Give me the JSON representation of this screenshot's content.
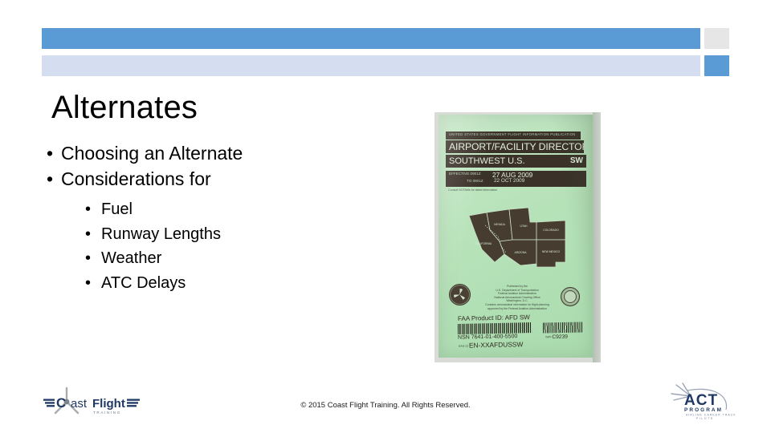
{
  "slide": {
    "title": "Alternates",
    "bullets": [
      {
        "text": "Choosing an Alternate",
        "marker": "•"
      },
      {
        "text": "Considerations for",
        "marker": "•"
      }
    ],
    "sub_bullets": [
      {
        "text": "Fuel",
        "marker": "•"
      },
      {
        "text": "Runway Lengths",
        "marker": "•"
      },
      {
        "text": "Weather",
        "marker": "•"
      },
      {
        "text": "ATC Delays",
        "marker": "•"
      }
    ]
  },
  "header": {
    "bar_top_color": "#5B9BD5",
    "block_top_right_color": "#E6E6E6",
    "bar_bottom_color": "#D4DEF0",
    "block_bottom_right_color": "#5B9BD5"
  },
  "photo": {
    "caption_alt": "Airport/Facility Directory Southwest U.S. booklet cover",
    "agency_line": "UNITED STATES GOVERNMENT FLIGHT INFORMATION PUBLICATION",
    "title": "AIRPORT/FACILITY DIRECTORY",
    "region": "SOUTHWEST U.S.",
    "region_code": "SW",
    "effective_label": "EFFECTIVE 0901Z",
    "effective_date": "27 AUG 2009",
    "to_label": "TO 0901Z",
    "to_date": "22 OCT 2009",
    "note": "Consult NOTAMs for latest information",
    "publisher_lines": [
      "Published by the",
      "U.S. Department of Transportation",
      "Federal Aviation Administration",
      "National Aeronautical Charting Office",
      "Washington, D.C.",
      "Contains aeronautical information for flight planning",
      "approved by the Federal Aviation Administration"
    ],
    "product_id": "FAA Product ID: AFD SW",
    "nsn": "NSN 7641-01-400-5500",
    "ean_prefix": "EAN-13",
    "ean": "EN-XXAFDUSSW",
    "barcode_code_prefix": "ISBN",
    "barcode_code": "C9239",
    "map_states": [
      "CALIFORNIA",
      "NEVADA",
      "UTAH",
      "COLORADO",
      "ARIZONA",
      "NEW MEXICO"
    ],
    "page_color": "#b8e3ba",
    "band_color": "#3a3128"
  },
  "footer": {
    "copyright": "© 2015 Coast Flight Training. All Rights Reserved.",
    "logo_left": {
      "name": "Coast Flight",
      "wordmark_part1": "C",
      "wordmark_part2": "oast",
      "wordmark_part3": "Flight",
      "tagline": "T  R  A  I  N  I  N  G",
      "color": "#1F3864"
    },
    "logo_right": {
      "name": "ACT Program",
      "wordmark": "ACT",
      "subtitle": "P R O G R A M",
      "tagline1": "AIRLINE CAREER TRACK",
      "tagline2": "P I L O T S",
      "color": "#1F3864"
    }
  }
}
